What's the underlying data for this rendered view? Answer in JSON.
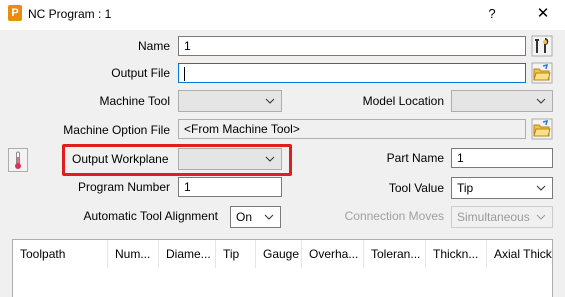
{
  "window": {
    "title": "NC Program : 1",
    "help": "?",
    "close": "✕",
    "app_icon": "P"
  },
  "form": {
    "name_label": "Name",
    "name_value": "1",
    "output_file_label": "Output File",
    "output_file_value": "",
    "machine_tool_label": "Machine Tool",
    "machine_tool_value": "",
    "model_location_label": "Model Location",
    "model_location_value": "",
    "machine_option_file_label": "Machine Option File",
    "machine_option_file_value": "<From Machine Tool>",
    "output_workplane_label": "Output Workplane",
    "output_workplane_value": "",
    "part_name_label": "Part Name",
    "part_name_value": "1",
    "program_number_label": "Program Number",
    "program_number_value": "1",
    "tool_value_label": "Tool Value",
    "tool_value_value": "Tip",
    "auto_tool_alignment_label": "Automatic Tool Alignment",
    "auto_tool_alignment_value": "On",
    "connection_moves_label": "Connection Moves",
    "connection_moves_value": "Simultaneous"
  },
  "table": {
    "columns": [
      "Toolpath",
      "Num...",
      "Diame...",
      "Tip",
      "Gauge",
      "Overha...",
      "Toleran...",
      "Thickn...",
      "Axial Thick"
    ]
  },
  "icons": {
    "name_action": "tool-wrench-icon",
    "browse": "open-folder-icon",
    "toolpath": "thermometer-icon"
  },
  "colors": {
    "highlight": "#e01e1e",
    "focus": "#0078d7",
    "folder": "#f2c24a",
    "accent": "#d6355a"
  }
}
